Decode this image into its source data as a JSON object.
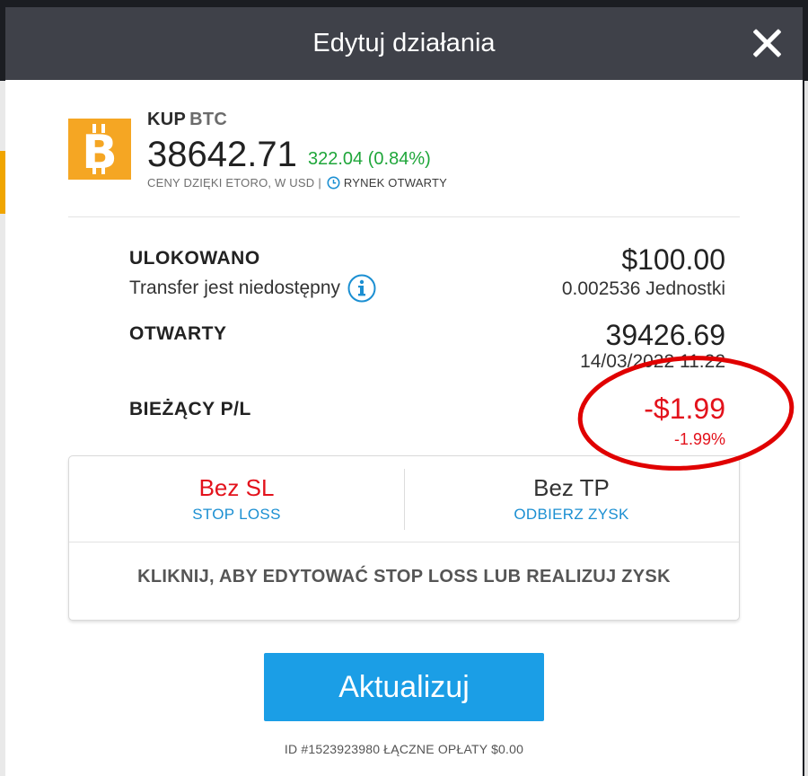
{
  "header": {
    "title": "Edytuj działania",
    "close_icon": "close-icon"
  },
  "asset": {
    "logo_icon": "bitcoin-icon",
    "logo_color": "#f5a623",
    "action": "KUP",
    "symbol": "BTC",
    "price": "38642.71",
    "change": "322.04 (0.84%)",
    "price_source": "CENY DZIĘKI ETORO, W USD",
    "separator": "|",
    "market_status": "RYNEK OTWARTY"
  },
  "details": {
    "invested_label": "ULOKOWANO",
    "invested_value": "$100.00",
    "transfer_note": "Transfer jest niedostępny",
    "units": "0.002536 Jednostki",
    "open_label": "OTWARTY",
    "open_price": "39426.69",
    "open_date": "14/03/2022 11:22",
    "pl_label": "BIEŻĄCY P/L",
    "pl_value": "-$1.99",
    "pl_percent": "-1.99%"
  },
  "sltp": {
    "stop_loss_value": "Bez SL",
    "stop_loss_label": "STOP LOSS",
    "take_profit_value": "Bez TP",
    "take_profit_label": "ODBIERZ ZYSK",
    "hint": "KLIKNIJ, ABY EDYTOWAĆ STOP LOSS LUB REALIZUJ ZYSK"
  },
  "actions": {
    "update_label": "Aktualizuj"
  },
  "footer": {
    "text": "ID #1523923980 ŁĄCZNE OPŁATY $0.00"
  },
  "colors": {
    "header_bg": "#3f4149",
    "positive": "#1fa63a",
    "negative": "#e3121c",
    "link_blue": "#1b8fd2",
    "button_blue": "#1b9ee6",
    "annotation_red": "#e00000"
  }
}
